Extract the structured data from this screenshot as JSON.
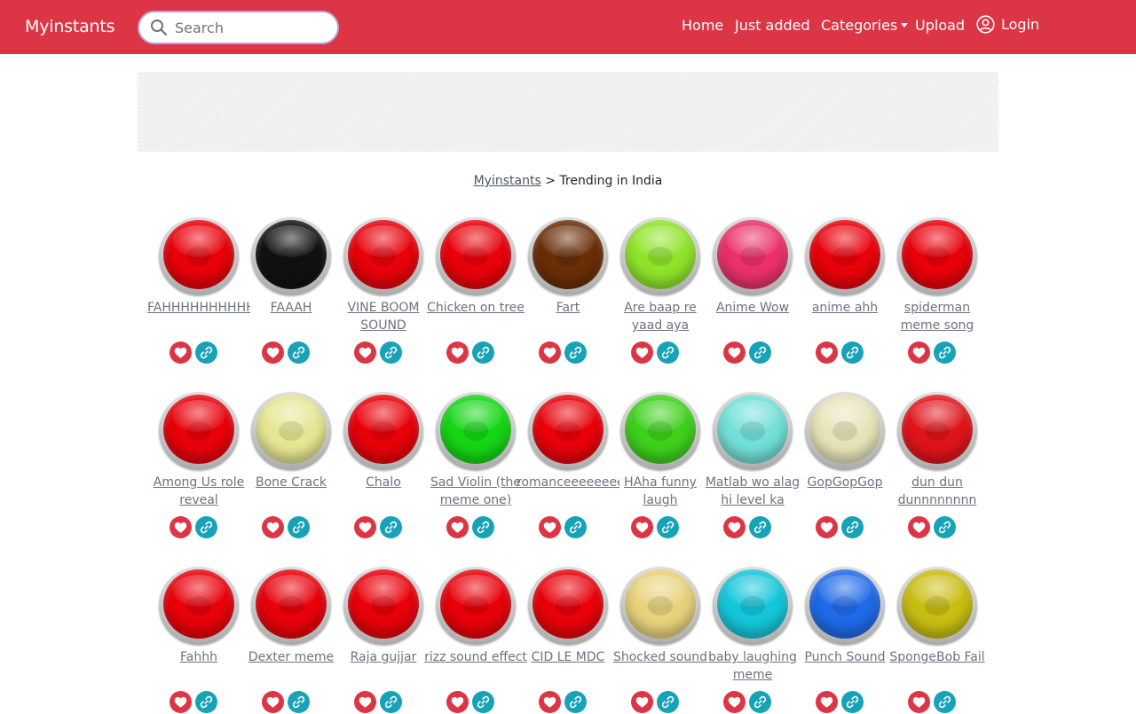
{
  "navbar": {
    "brand": "Myinstants",
    "search_placeholder": "Search",
    "links": {
      "home": "Home",
      "just_added": "Just added",
      "categories": "Categories",
      "upload": "Upload",
      "login": "Login"
    },
    "color": "#dc3545"
  },
  "breadcrumb": {
    "root": "Myinstants",
    "separator": " > ",
    "current": "Trending in India"
  },
  "instants": [
    {
      "title": "FAHHHHHHHHHHHHHH",
      "color": "#e8000a"
    },
    {
      "title": "FAAAH",
      "color": "#111111"
    },
    {
      "title": "VINE BOOM SOUND",
      "color": "#e8000a"
    },
    {
      "title": "Chicken on tree",
      "color": "#e8000a"
    },
    {
      "title": "Fart",
      "color": "#6a2e08"
    },
    {
      "title": "Are baap re yaad aya",
      "color": "#8fe42a"
    },
    {
      "title": "Anime Wow",
      "color": "#ea3169"
    },
    {
      "title": "anime ahh",
      "color": "#e8000a"
    },
    {
      "title": "spiderman meme song",
      "color": "#e8000a"
    },
    {
      "title": "Among Us role reveal",
      "color": "#e8000a"
    },
    {
      "title": "Bone Crack",
      "color": "#e6e693"
    },
    {
      "title": "Chalo",
      "color": "#e8000a"
    },
    {
      "title": "Sad Violin (the meme one)",
      "color": "#15d615"
    },
    {
      "title": "romanceeeeeeeeeeeeee",
      "color": "#e8000a"
    },
    {
      "title": "HAha funny laugh",
      "color": "#3ed11c"
    },
    {
      "title": "Matlab wo alag hi level ka",
      "color": "#72e0d8"
    },
    {
      "title": "GopGopGop",
      "color": "#e8e4b9"
    },
    {
      "title": "dun dun dunnnnnnnn",
      "color": "#e0141b"
    },
    {
      "title": "Fahhh",
      "color": "#e8000a"
    },
    {
      "title": "Dexter meme",
      "color": "#e8000a"
    },
    {
      "title": "Raja gujjar",
      "color": "#e8000a"
    },
    {
      "title": "rizz sound effect",
      "color": "#e8000a"
    },
    {
      "title": "CID LE MDC",
      "color": "#e8000a"
    },
    {
      "title": "Shocked sound",
      "color": "#e8d27c"
    },
    {
      "title": "baby laughing meme",
      "color": "#14c6da"
    },
    {
      "title": "Punch Sound",
      "color": "#1f6ae8"
    },
    {
      "title": "SpongeBob Fail",
      "color": "#c8be12"
    }
  ]
}
